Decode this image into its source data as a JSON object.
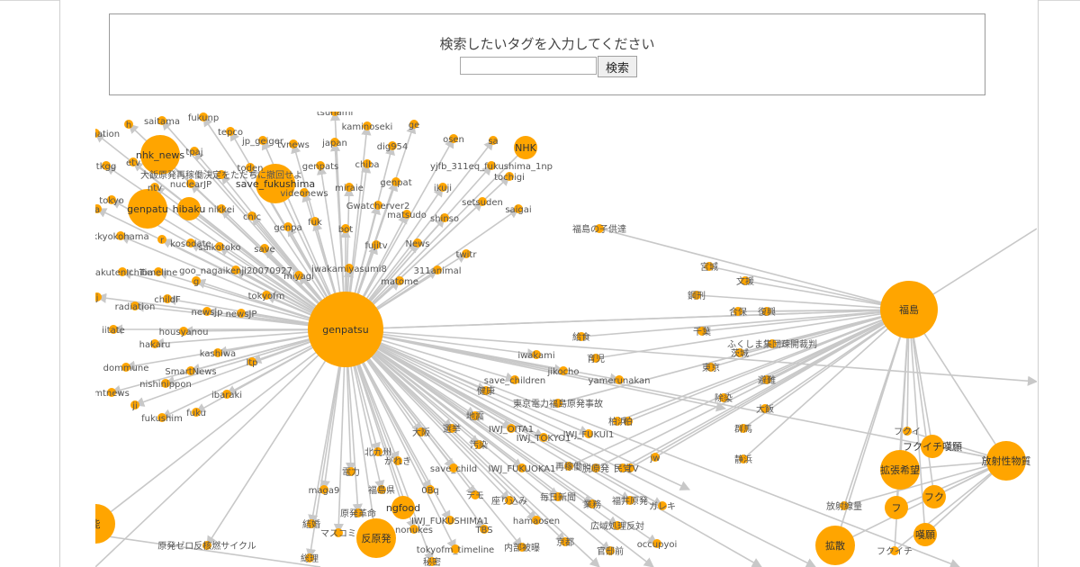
{
  "search": {
    "title": "検索したいタグを入力してください",
    "input_value": "",
    "button_label": "検索"
  },
  "graph": {
    "center_node": "genpatsu",
    "hub_nodes": [
      "福島",
      "放射性物質"
    ],
    "nodes": [
      {
        "label": "genpatsu",
        "size": "xl"
      },
      {
        "label": "福島",
        "size": "lg"
      },
      {
        "label": "放射性物質",
        "size": "md"
      },
      {
        "label": "拡散",
        "size": "md"
      },
      {
        "label": "拡張希望",
        "size": "md"
      },
      {
        "label": "反原発",
        "size": "md"
      },
      {
        "label": "genpatu",
        "size": "md"
      },
      {
        "label": "hibaku",
        "size": "sm"
      },
      {
        "label": "NHK",
        "size": "sm"
      },
      {
        "label": "nhk_news",
        "size": "md"
      },
      {
        "label": "save_fukushima",
        "size": "md"
      },
      {
        "label": "ngfood",
        "size": "sm"
      },
      {
        "label": "嘆願",
        "size": "sm"
      },
      {
        "label": "フクイチ嘆願",
        "size": "sm"
      },
      {
        "label": "フクイ",
        "size": "xs"
      },
      {
        "label": "フク",
        "size": "sm"
      },
      {
        "label": "フ",
        "size": "sm"
      },
      {
        "label": "フクイチ",
        "size": "xs"
      },
      {
        "label": "放射線量",
        "size": "xs"
      },
      {
        "label": "能",
        "size": "md"
      },
      {
        "label": "福島の子供達",
        "size": "xs"
      },
      {
        "label": "tamination",
        "size": "xs"
      },
      {
        "label": "h",
        "size": "xs"
      },
      {
        "label": "saitama",
        "size": "xs"
      },
      {
        "label": "fukunp",
        "size": "xs"
      },
      {
        "label": "kaminoseki",
        "size": "xs"
      },
      {
        "label": "ge",
        "size": "xs"
      },
      {
        "label": "tsunami",
        "size": "xs"
      },
      {
        "label": "tepco",
        "size": "xs"
      },
      {
        "label": "tpaj",
        "size": "xs"
      },
      {
        "label": "jp_geiger",
        "size": "xs"
      },
      {
        "label": "tvnews",
        "size": "xs"
      },
      {
        "label": "japan",
        "size": "xs"
      },
      {
        "label": "dig954",
        "size": "xs"
      },
      {
        "label": "osen",
        "size": "xs"
      },
      {
        "label": "sa",
        "size": "xs"
      },
      {
        "label": "tkgg",
        "size": "xs"
      },
      {
        "label": "etv",
        "size": "xs"
      },
      {
        "label": "大飯原発再稼働決定をただちに撤回せよ",
        "size": "xs"
      },
      {
        "label": "toden",
        "size": "xs"
      },
      {
        "label": "genpats",
        "size": "xs"
      },
      {
        "label": "chiba",
        "size": "xs"
      },
      {
        "label": "yjfb_311eq_fukushima_1np",
        "size": "xs"
      },
      {
        "label": "ntv",
        "size": "xs"
      },
      {
        "label": "nuclearJP",
        "size": "xs"
      },
      {
        "label": "videonews",
        "size": "xs"
      },
      {
        "label": "miraie",
        "size": "xs"
      },
      {
        "label": "genpat",
        "size": "xs"
      },
      {
        "label": "ikuji",
        "size": "xs"
      },
      {
        "label": "tochigi",
        "size": "xs"
      },
      {
        "label": "tokyo",
        "size": "xs"
      },
      {
        "label": "a",
        "size": "xs"
      },
      {
        "label": "nikkei",
        "size": "xs"
      },
      {
        "label": "cnic",
        "size": "xs"
      },
      {
        "label": "Gwatcherver2",
        "size": "xs"
      },
      {
        "label": "matsudo",
        "size": "xs"
      },
      {
        "label": "setsuden",
        "size": "xs"
      },
      {
        "label": "saigai",
        "size": "xs"
      },
      {
        "label": "shinso",
        "size": "xs"
      },
      {
        "label": "fuk",
        "size": "xs"
      },
      {
        "label": "genpa",
        "size": "xs"
      },
      {
        "label": "bot",
        "size": "xs"
      },
      {
        "label": "kkyokohama",
        "size": "xs"
      },
      {
        "label": "r",
        "size": "xs"
      },
      {
        "label": "kosodate",
        "size": "xs"
      },
      {
        "label": "saikotoko",
        "size": "xs"
      },
      {
        "label": "save",
        "size": "xs"
      },
      {
        "label": "fujitv",
        "size": "xs"
      },
      {
        "label": "News",
        "size": "xs"
      },
      {
        "label": "twitr",
        "size": "xs"
      },
      {
        "label": "rakutenIchiba",
        "size": "xs"
      },
      {
        "label": "Timeline",
        "size": "xs"
      },
      {
        "label": "goo_nagaikenji20070927",
        "size": "xs"
      },
      {
        "label": "miyagi",
        "size": "xs"
      },
      {
        "label": "iwakamiyasumi8",
        "size": "xs"
      },
      {
        "label": "311animal",
        "size": "xs"
      },
      {
        "label": "matome",
        "size": "xs"
      },
      {
        "label": "g",
        "size": "xs"
      },
      {
        "label": "j",
        "size": "xs"
      },
      {
        "label": "childF",
        "size": "xs"
      },
      {
        "label": "tokyofm",
        "size": "xs"
      },
      {
        "label": "radiation",
        "size": "xs"
      },
      {
        "label": "newsjp",
        "size": "xs"
      },
      {
        "label": "newsJP",
        "size": "xs"
      },
      {
        "label": "iitate",
        "size": "xs"
      },
      {
        "label": "housyanou",
        "size": "xs"
      },
      {
        "label": "hakaru",
        "size": "xs"
      },
      {
        "label": "kashiwa",
        "size": "xs"
      },
      {
        "label": "ltp",
        "size": "xs"
      },
      {
        "label": "dommune",
        "size": "xs"
      },
      {
        "label": "SmartNews",
        "size": "xs"
      },
      {
        "label": "nishinippon",
        "size": "xs"
      },
      {
        "label": "mtnews",
        "size": "xs"
      },
      {
        "label": "ibaraki",
        "size": "xs"
      },
      {
        "label": "ji",
        "size": "xs"
      },
      {
        "label": "fukushim",
        "size": "xs"
      },
      {
        "label": "fuku",
        "size": "xs"
      },
      {
        "label": "iwakami",
        "size": "xs"
      },
      {
        "label": "save_children",
        "size": "xs"
      },
      {
        "label": "jikocho",
        "size": "xs"
      },
      {
        "label": "yamerunakan",
        "size": "xs"
      },
      {
        "label": "IWJ_OITA1",
        "size": "xs"
      },
      {
        "label": "IWJ_TOKYO1",
        "size": "xs"
      },
      {
        "label": "IWJ_FUKUI1",
        "size": "xs"
      },
      {
        "label": "IWJ_FUKUOKA1",
        "size": "xs"
      },
      {
        "label": "IWJ_FUKUSHIMA1",
        "size": "xs"
      },
      {
        "label": "save_child",
        "size": "xs"
      },
      {
        "label": "ETV",
        "size": "xs"
      },
      {
        "label": "maga9",
        "size": "xs"
      },
      {
        "label": "0Bq",
        "size": "xs"
      },
      {
        "label": "hamaosen",
        "size": "xs"
      },
      {
        "label": "nonukes",
        "size": "xs"
      },
      {
        "label": "TBS",
        "size": "xs"
      },
      {
        "label": "tokyofm_timeline",
        "size": "xs"
      },
      {
        "label": "occupyoi",
        "size": "xs"
      },
      {
        "label": "jw",
        "size": "xs"
      },
      {
        "label": "原発ゼロ反核燃サイクル",
        "size": "xs"
      },
      {
        "label": "宮城",
        "size": "xs"
      },
      {
        "label": "文援",
        "size": "xs"
      },
      {
        "label": "鋼刑",
        "size": "xs"
      },
      {
        "label": "合保",
        "size": "xs"
      },
      {
        "label": "復興",
        "size": "xs"
      },
      {
        "label": "千葉",
        "size": "xs"
      },
      {
        "label": "ふくしま集団疎開裁判",
        "size": "xs"
      },
      {
        "label": "茨城",
        "size": "xs"
      },
      {
        "label": "東京",
        "size": "xs"
      },
      {
        "label": "避難",
        "size": "xs"
      },
      {
        "label": "除染",
        "size": "xs"
      },
      {
        "label": "大飯",
        "size": "xs"
      },
      {
        "label": "群馬",
        "size": "xs"
      },
      {
        "label": "静浜",
        "size": "xs"
      },
      {
        "label": "給食",
        "size": "xs"
      },
      {
        "label": "育児",
        "size": "xs"
      },
      {
        "label": "東京電力福島原発事故",
        "size": "xs"
      },
      {
        "label": "健康",
        "size": "xs"
      },
      {
        "label": "地震",
        "size": "xs"
      },
      {
        "label": "選挙",
        "size": "xs"
      },
      {
        "label": "汚染",
        "size": "xs"
      },
      {
        "label": "大阪",
        "size": "xs"
      },
      {
        "label": "北九州",
        "size": "xs"
      },
      {
        "label": "がれき",
        "size": "xs"
      },
      {
        "label": "電力",
        "size": "xs"
      },
      {
        "label": "福島県",
        "size": "xs"
      },
      {
        "label": "再稼働",
        "size": "xs"
      },
      {
        "label": "脱原発",
        "size": "xs"
      },
      {
        "label": "デモ",
        "size": "xs"
      },
      {
        "label": "座り込み",
        "size": "xs"
      },
      {
        "label": "毎日新聞",
        "size": "xs"
      },
      {
        "label": "福井原発",
        "size": "xs"
      },
      {
        "label": "ガレキ",
        "size": "xs"
      },
      {
        "label": "柏",
        "size": "xs"
      },
      {
        "label": "業務",
        "size": "xs"
      },
      {
        "label": "原発革命",
        "size": "xs"
      },
      {
        "label": "マスコミ",
        "size": "xs"
      },
      {
        "label": "内部被曝",
        "size": "xs"
      },
      {
        "label": "広域処理反対",
        "size": "xs"
      },
      {
        "label": "京都",
        "size": "xs"
      },
      {
        "label": "官邸前",
        "size": "xs"
      },
      {
        "label": "総理",
        "size": "xs"
      },
      {
        "label": "秘密",
        "size": "xs"
      },
      {
        "label": "民党",
        "size": "xs"
      },
      {
        "label": "柏浜",
        "size": "xs"
      },
      {
        "label": "結婚",
        "size": "xs"
      }
    ]
  },
  "colors": {
    "node_fill": "#ffa500",
    "edge": "#c8c8c8",
    "label": "#555555"
  }
}
